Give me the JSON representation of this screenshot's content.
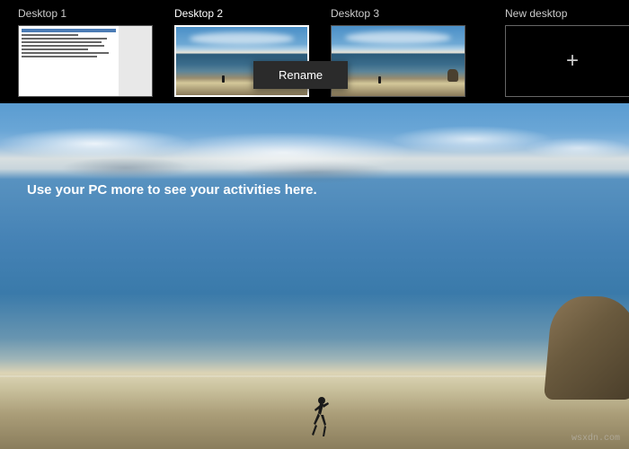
{
  "desktops": [
    {
      "label": "Desktop 1",
      "active": false,
      "type": "app"
    },
    {
      "label": "Desktop 2",
      "active": true,
      "type": "wallpaper"
    },
    {
      "label": "Desktop 3",
      "active": false,
      "type": "wallpaper"
    }
  ],
  "new_desktop": {
    "label": "New desktop",
    "icon": "+"
  },
  "context_menu": {
    "rename": "Rename"
  },
  "main": {
    "activity_hint": "Use your PC more to see your activities here."
  },
  "watermark": "wsxdn.com"
}
